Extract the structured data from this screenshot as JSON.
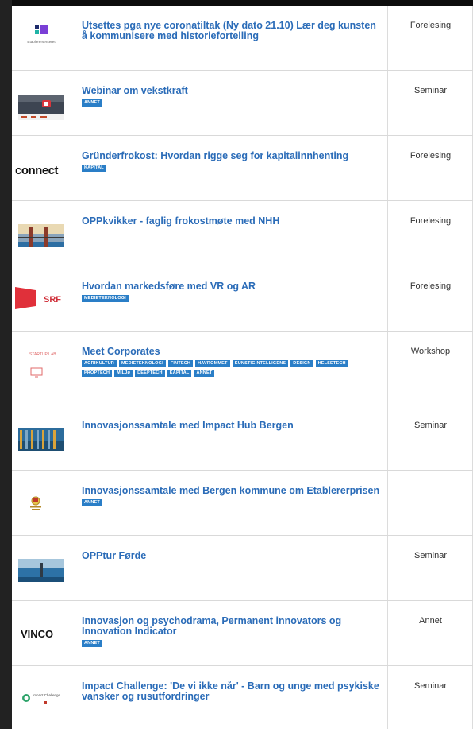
{
  "header": {
    "partial_text": "g..."
  },
  "events": [
    {
      "thumb": "etablerersenteret-logo",
      "logo_text": "Etablerersenteret",
      "title": "Utsettes pga nye coronatiltak (Ny dato 21.10) Lær deg kunsten å kommunisere med historiefortelling",
      "tags": [],
      "type": "Forelesing"
    },
    {
      "thumb": "webinar-image",
      "title": "Webinar om vekstkraft",
      "tags": [
        "ANNET"
      ],
      "type": "Seminar"
    },
    {
      "thumb": "connect-logo",
      "logo_text": "connect",
      "title": "Gründerfrokost: Hvordan rigge seg for kapitalinnhenting",
      "tags": [
        "KAPITAL"
      ],
      "type": "Forelesing"
    },
    {
      "thumb": "harbor-image",
      "title": "OPPkvikker - faglig frokostmøte med NHH",
      "tags": [],
      "type": "Forelesing"
    },
    {
      "thumb": "srf-logo",
      "logo_text": "SRF",
      "title": "Hvordan markedsføre med VR og AR",
      "tags": [
        "MEDIETEKNOLOGI"
      ],
      "type": "Forelesing"
    },
    {
      "thumb": "startup-lab-logo",
      "logo_text": "STARTUP LAB",
      "title": "Meet Corporates",
      "tags": [
        "AGRIKULTUR",
        "MEDIETEKNOLOGI",
        "FINTECH",
        "HAVROMMET",
        "KUNSTIGINTELLIGENS",
        "DESIGN",
        "HELSETECH",
        "PROPTECH",
        "MILJø",
        "DEEPTECH",
        "KAPITAL",
        "ANNET"
      ],
      "type": "Workshop"
    },
    {
      "thumb": "hub-image",
      "title": "Innovasjonssamtale med Impact Hub Bergen",
      "tags": [],
      "type": "Seminar"
    },
    {
      "thumb": "bergen-kommune-logo",
      "title": "Innovasjonssamtale med Bergen kommune om Etablererprisen",
      "tags": [
        "ANNET"
      ],
      "type": ""
    },
    {
      "thumb": "forde-image",
      "title": "OPPtur Førde",
      "tags": [],
      "type": "Seminar"
    },
    {
      "thumb": "vinco-logo",
      "logo_text": "VINCO",
      "title": "Innovasjon og psychodrama, Permanent innovators og Innovation Indicator",
      "tags": [
        "ANNET"
      ],
      "type": "Annet"
    },
    {
      "thumb": "impact-challenge-logo",
      "logo_text": "Impact Challenge",
      "title": "Impact Challenge: 'De vi ikke når' - Barn og unge med psykiske vansker og rusutfordringer",
      "tags": [],
      "type": "Seminar"
    }
  ]
}
